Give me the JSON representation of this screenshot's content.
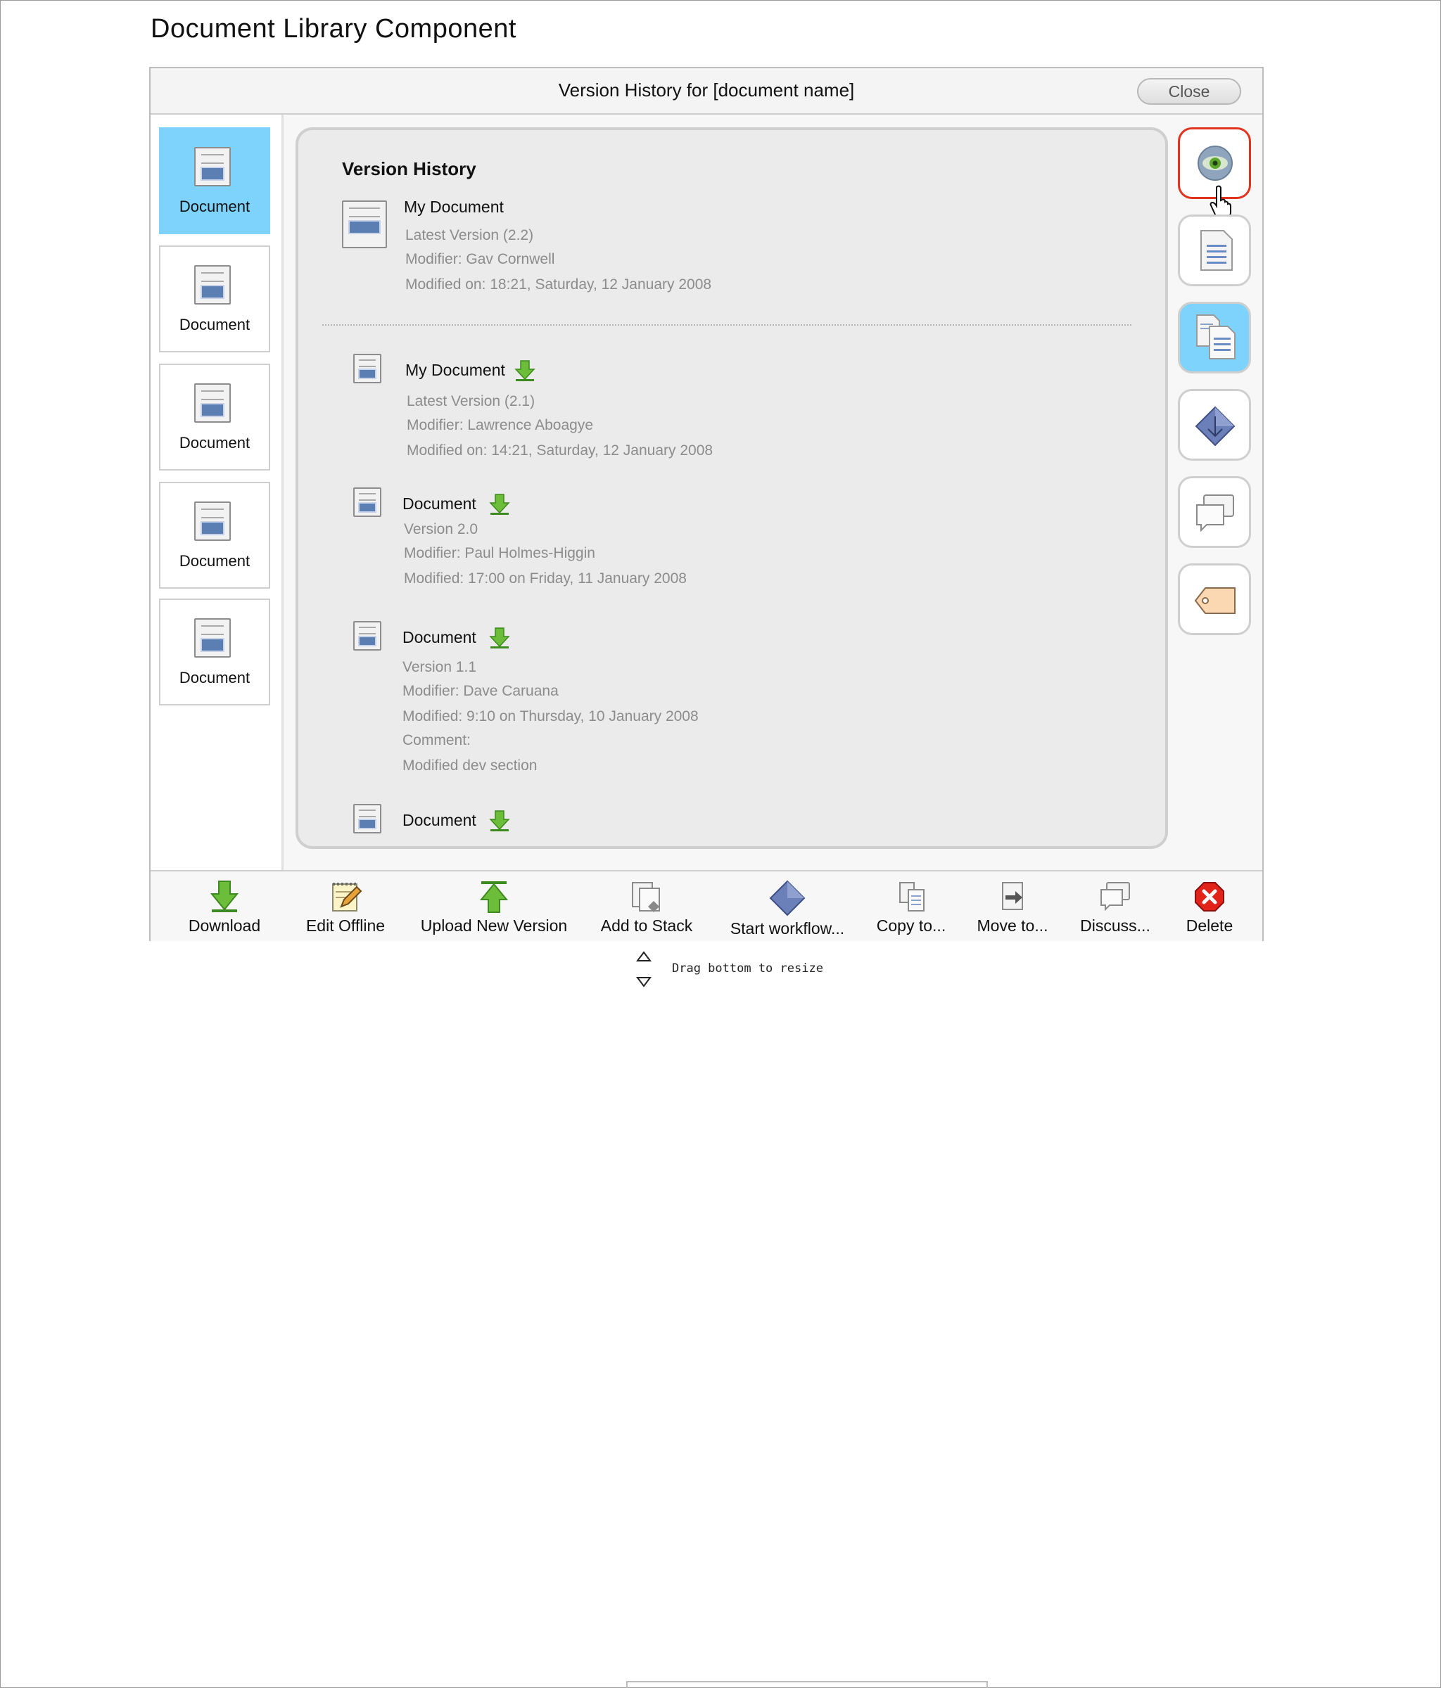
{
  "page": {
    "title": "Document Library Component"
  },
  "dialog": {
    "title": "Version History for [document name]",
    "close_label": "Close"
  },
  "thumbnails": [
    {
      "label": "Document",
      "selected": true
    },
    {
      "label": "Document",
      "selected": false
    },
    {
      "label": "Document",
      "selected": false
    },
    {
      "label": "Document",
      "selected": false
    },
    {
      "label": "Document",
      "selected": false
    }
  ],
  "version_history": {
    "heading": "Version History",
    "current": {
      "name": "My Document",
      "version": "Latest Version (2.2)",
      "modifier": "Modifier: Gav Cornwell",
      "modified": "Modified on: 18:21, Saturday, 12 January 2008"
    },
    "versions": [
      {
        "name": "My Document",
        "version": "Latest Version (2.1)",
        "modifier": "Modifier: Lawrence Aboagye",
        "modified": "Modified on: 14:21, Saturday, 12 January 2008"
      },
      {
        "name": "Document",
        "version": "Version 2.0",
        "modifier": "Modifier: Paul Holmes-Higgin",
        "modified": "Modified: 17:00 on Friday, 11 January 2008"
      },
      {
        "name": "Document",
        "version": "Version 1.1",
        "modifier": "Modifier: Dave Caruana",
        "modified": "Modified: 9:10 on Thursday, 10 January 2008",
        "comment_label": "Comment:",
        "comment": "Modified dev section"
      },
      {
        "name": "Document"
      }
    ]
  },
  "side_actions": [
    {
      "icon": "eye-icon",
      "state": "hover"
    },
    {
      "icon": "document-details-icon",
      "state": "normal"
    },
    {
      "icon": "copy-documents-icon",
      "state": "selected"
    },
    {
      "icon": "workflow-diamond-icon",
      "state": "normal"
    },
    {
      "icon": "discussion-icon",
      "state": "normal"
    },
    {
      "icon": "tag-icon",
      "state": "normal"
    }
  ],
  "toolbar": {
    "download": "Download",
    "edit_offline": "Edit Offline",
    "upload_new_version": "Upload New Version",
    "add_to_stack": "Add to Stack",
    "start_workflow": "Start workflow...",
    "copy_to": "Copy to...",
    "move_to": "Move to...",
    "discuss": "Discuss...",
    "delete": "Delete"
  },
  "resize_hint": "Drag bottom to resize",
  "colors": {
    "selected_bg": "#7dd3fb",
    "active_border": "#e2331f",
    "download_green": "#5aa52b",
    "doc_blue": "#5b7eb3"
  }
}
